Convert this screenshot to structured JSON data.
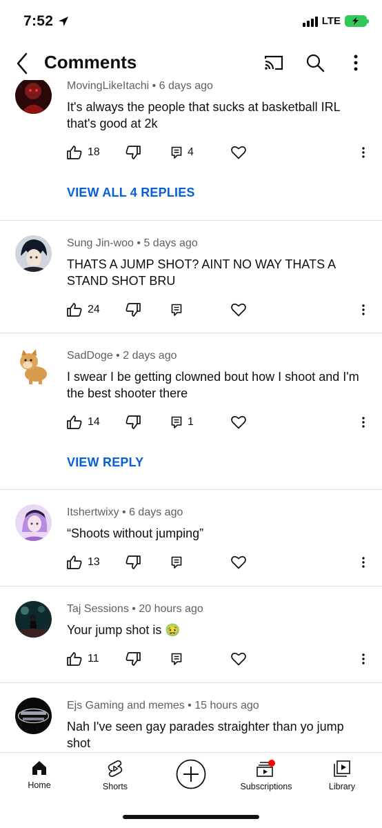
{
  "status": {
    "time": "7:52",
    "network": "LTE"
  },
  "header": {
    "title": "Comments"
  },
  "comments": [
    {
      "author": "MovingLikeItachi",
      "age": "6 days ago",
      "text": "It's always the people that sucks at basketball IRL that's good at 2k",
      "likes": "18",
      "reply_count": "4",
      "replies_link": "VIEW ALL 4 REPLIES",
      "avatar_color": "#5a1010"
    },
    {
      "author": "Sung Jin-woo",
      "age": "5 days ago",
      "text": "THATS A JUMP SHOT? AINT NO WAY THATS A STAND SHOT BRU",
      "likes": "24",
      "reply_count": "",
      "avatar_color": "#1e2430"
    },
    {
      "author": "SadDoge",
      "age": "2 days ago",
      "text": "I swear I be getting clowned bout how I shoot and I'm the best shooter there",
      "likes": "14",
      "reply_count": "1",
      "replies_link": "VIEW REPLY",
      "avatar_color": "#d99a4a"
    },
    {
      "author": "Itshertwixy",
      "age": "6 days ago",
      "text": "“Shoots without jumping”",
      "likes": "13",
      "reply_count": "",
      "avatar_color": "#c8a0e8"
    },
    {
      "author": "Taj Sessions",
      "age": "20 hours ago",
      "text": "Your jump shot is 🤢",
      "likes": "11",
      "reply_count": "",
      "avatar_color": "#1f3a3a"
    },
    {
      "author": "Ejs Gaming and memes",
      "age": "15 hours ago",
      "text": "Nah I've seen gay parades straighter than yo jump shot",
      "likes": "",
      "reply_count": "",
      "avatar_color": "#0a0a0a"
    }
  ],
  "nav": {
    "home": "Home",
    "shorts": "Shorts",
    "subscriptions": "Subscriptions",
    "library": "Library"
  },
  "colors": {
    "link": "#065fd4",
    "meta": "#606060",
    "notification_dot": "#ff0000"
  }
}
